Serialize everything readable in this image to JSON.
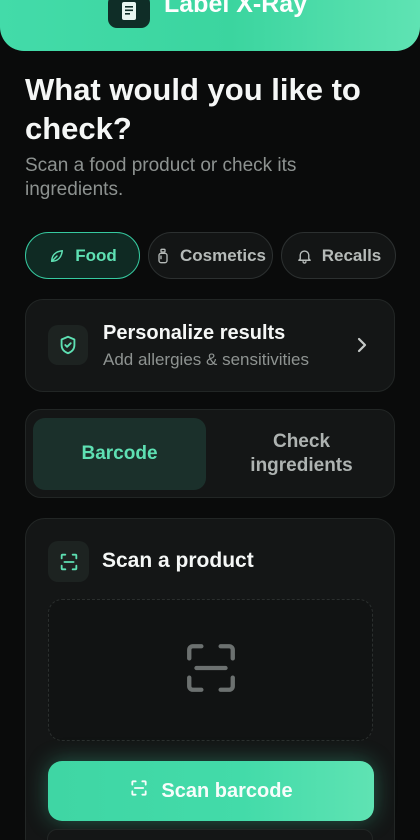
{
  "app": {
    "title": "Label X-Ray",
    "accent_color": "#43dba9",
    "logo_icon": "label-scan-logo-icon"
  },
  "intro": {
    "headline": "What would you like to check?",
    "subtitle": "Scan a food product or check its ingredients."
  },
  "categories": [
    {
      "label": "Food",
      "icon": "leaf-icon",
      "active": true
    },
    {
      "label": "Cosmetics",
      "icon": "bottle-icon",
      "active": false
    },
    {
      "label": "Recalls",
      "icon": "bell-icon",
      "active": false
    }
  ],
  "personalize": {
    "title": "Personalize results",
    "subtitle": "Add allergies & sensitivities",
    "icon": "shield-check-icon",
    "chevron": "chevron-right-icon"
  },
  "mode": {
    "options": [
      {
        "label": "Barcode",
        "active": true
      },
      {
        "label": "Check ingredients",
        "active": false
      }
    ]
  },
  "scan": {
    "title": "Scan a product",
    "icon": "scan-frame-icon",
    "viewfinder_icon": "barcode-scan-icon",
    "button_label": "Scan barcode"
  }
}
